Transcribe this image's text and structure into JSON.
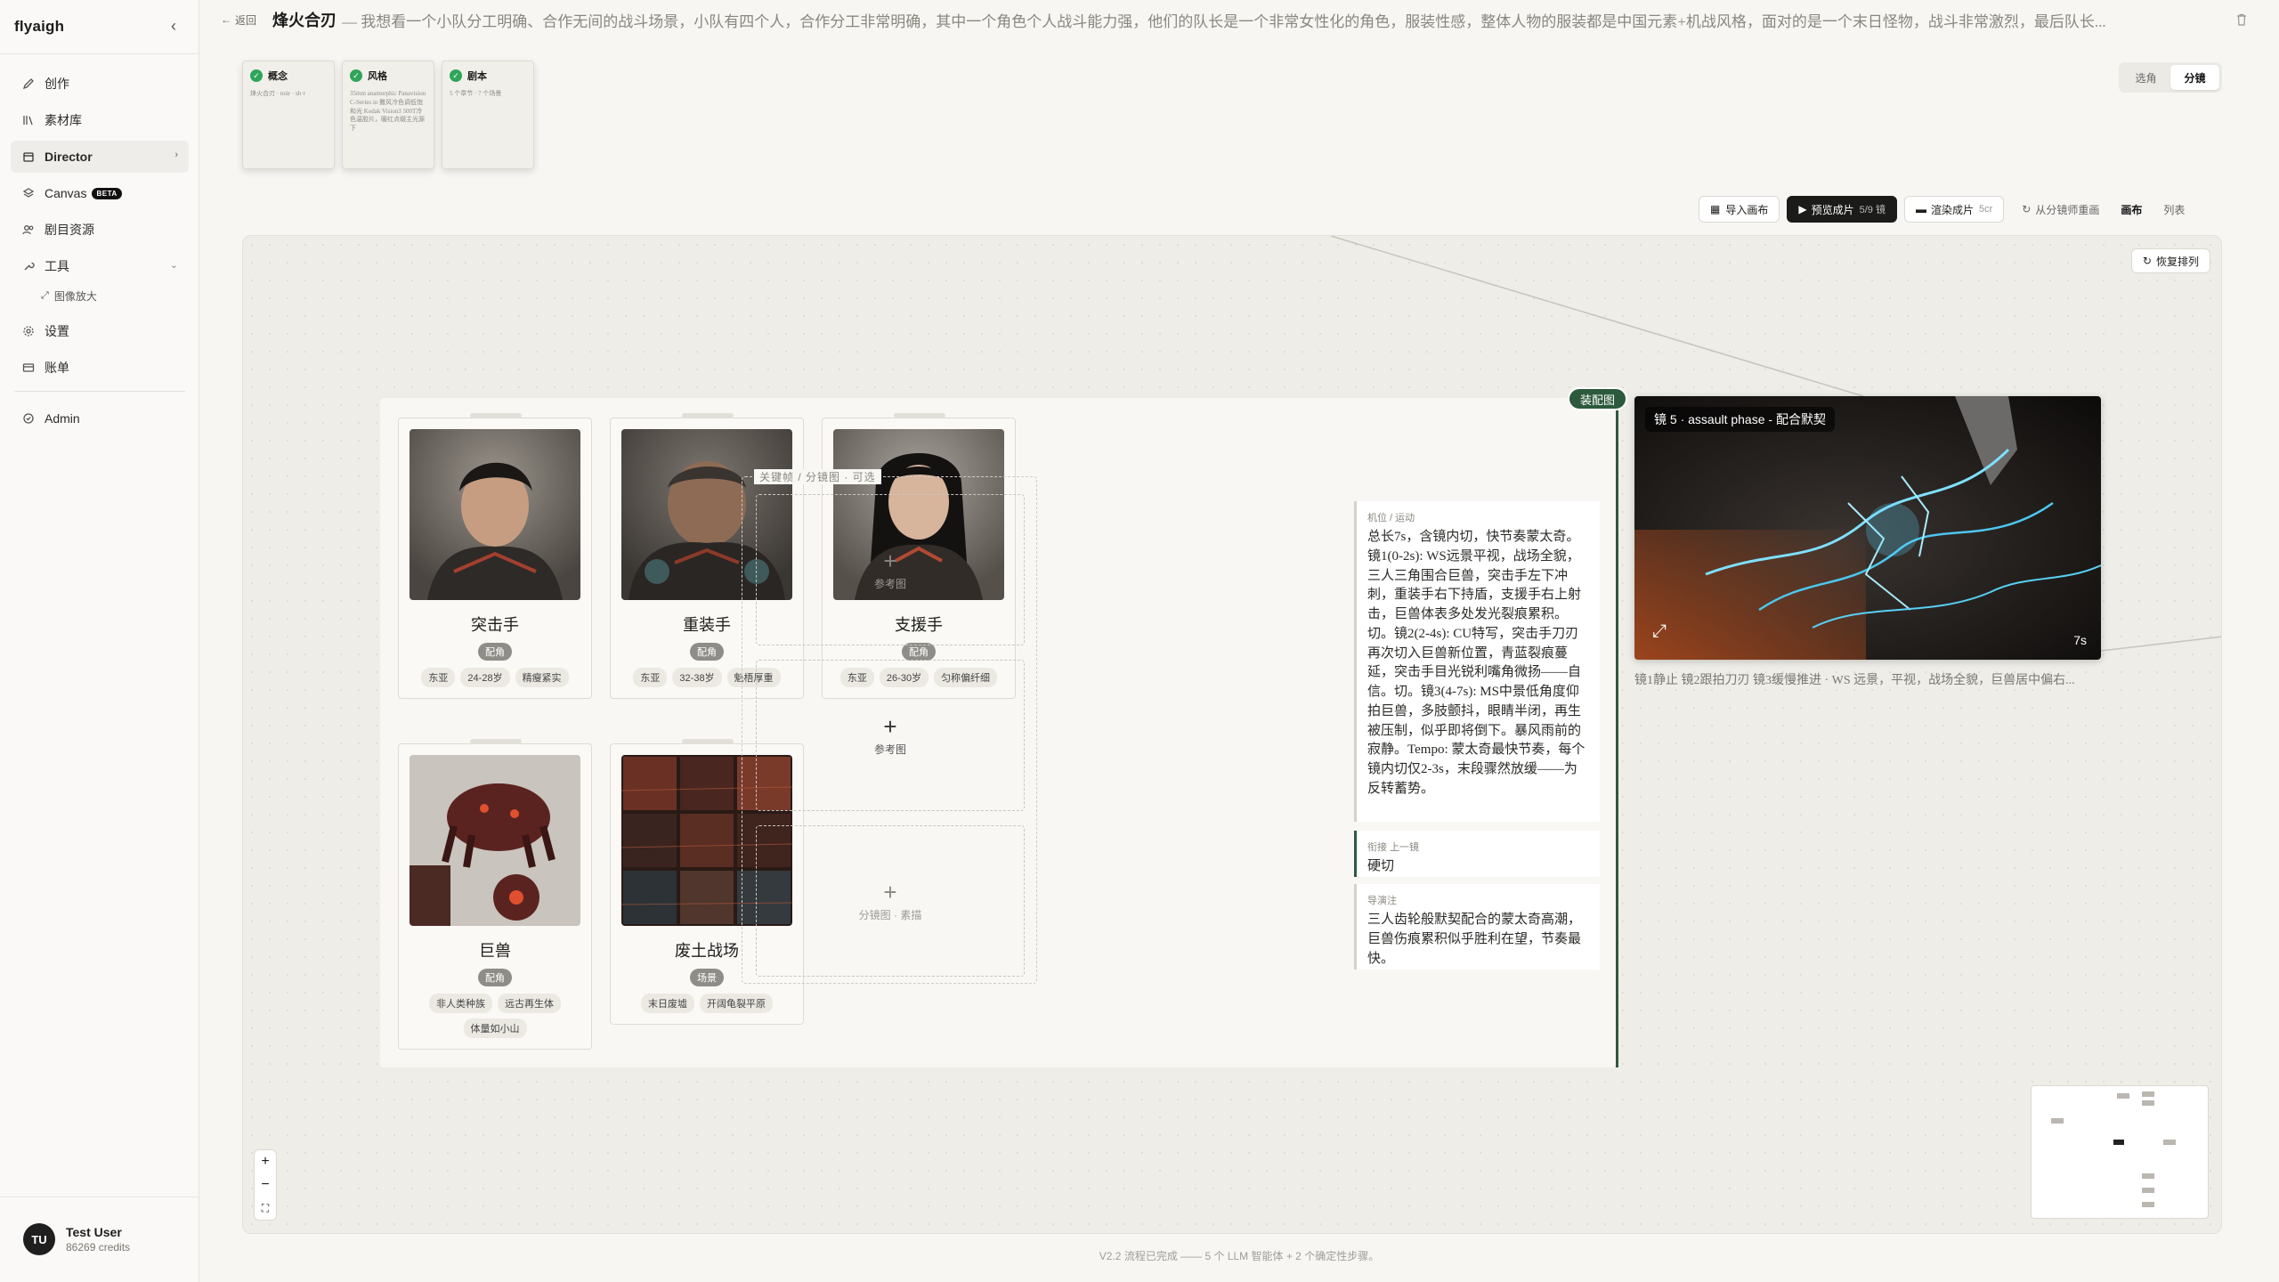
{
  "app": {
    "name": "flyaigh",
    "collapse_icon": "chevron-left-icon"
  },
  "sidebar": {
    "items": [
      {
        "label": "创作",
        "icon": "edit-icon"
      },
      {
        "label": "素材库",
        "icon": "library-icon"
      },
      {
        "label": "Director",
        "icon": "film-icon"
      },
      {
        "label": "Canvas",
        "badge": "BETA",
        "icon": "layers-icon"
      },
      {
        "label": "剧目资源",
        "icon": "users-icon"
      },
      {
        "label": "工具",
        "icon": "wrench-icon"
      },
      {
        "label": "设置",
        "icon": "gear-icon"
      },
      {
        "label": "账单",
        "icon": "card-icon"
      },
      {
        "label": "Admin",
        "icon": "shield-icon"
      }
    ],
    "subitems": [
      {
        "label": "图像放大",
        "icon": "expand-icon"
      }
    ],
    "user": {
      "initials": "TU",
      "name": "Test User",
      "credits": "86269 credits"
    }
  },
  "header": {
    "back_label": "返回",
    "title": "烽火合刃",
    "description": "— 我想看一个小队分工明确、合作无间的战斗场景，小队有四个人，合作分工非常明确，其中一个角色个人战斗能力强，他们的队长是一个非常女性化的角色，服装性感，整体人物的服装都是中国元素+机战风格，面对的是一个末日怪物，战斗非常激烈，最后队长..."
  },
  "stages": [
    {
      "label": "概念",
      "sub": "烽火合刃 · noir · sh·r"
    },
    {
      "label": "风格",
      "sub": "35mm anamorphic Panavision C-Series in 撒风冷色调低饱和光 Kodak Vision3 500T冷色温胶片，暖红点缀主光源下"
    },
    {
      "label": "剧本",
      "sub": "5 个章节 · 7 个场景"
    }
  ],
  "mode_toggle": {
    "left": "选角",
    "right": "分镜"
  },
  "toolbar": {
    "import": "导入画布",
    "preview": "预览成片",
    "preview_count": "5/9 镜",
    "render": "渲染成片",
    "render_count": "5cr",
    "redraw": "从分镜师重画",
    "view_canvas": "画布",
    "view_list": "列表"
  },
  "canvas": {
    "reset_label": "恢复排列",
    "board_tag": "装配图",
    "characters": [
      {
        "name": "突击手",
        "role": "配角",
        "tags": [
          "东亚",
          "24-28岁",
          "精瘦紧实"
        ]
      },
      {
        "name": "重装手",
        "role": "配角",
        "tags": [
          "东亚",
          "32-38岁",
          "魁梧厚重"
        ]
      },
      {
        "name": "支援手",
        "role": "配角",
        "tags": [
          "东亚",
          "26-30岁",
          "匀称偏纤细"
        ]
      },
      {
        "name": "巨兽",
        "role": "配角",
        "tags": [
          "非人类种族",
          "远古再生体",
          "体量如小山"
        ]
      },
      {
        "name": "废土战场",
        "role": "场景",
        "tags": [
          "末日废墟",
          "开阔龟裂平原"
        ]
      }
    ],
    "keyframe_label": "关键帧 / 分镜图 · 可选",
    "ref_boxes": [
      "参考图",
      "参考图",
      "分镜图 · 素描"
    ],
    "info": [
      {
        "caption": "机位 / 运动",
        "text": "总长7s，含镜内切，快节奏蒙太奇。镜1(0-2s): WS远景平视，战场全貌，三人三角围合巨兽，突击手左下冲刺，重装手右下持盾，支援手右上射击，巨兽体表多处发光裂痕累积。切。镜2(2-4s): CU特写，突击手刀刃再次切入巨兽新位置，青蓝裂痕蔓延，突击手目光锐利嘴角微扬——自信。切。镜3(4-7s): MS中景低角度仰拍巨兽，多肢颤抖，眼睛半闭，再生被压制，似乎即将倒下。暴风雨前的寂静。Tempo: 蒙太奇最快节奏，每个镜内切仅2-3s，末段骤然放缓——为反转蓄势。"
      },
      {
        "caption": "衔接 上一镜",
        "text": "硬切"
      },
      {
        "caption": "导演注",
        "text": "三人齿轮般默契配合的蒙太奇高潮，巨兽伤痕累积似乎胜利在望，节奏最快。"
      }
    ],
    "shot": {
      "title": "镜 5 · assault phase - 配合默契",
      "duration": "7s",
      "caption": "镜1静止 镜2跟拍刀刃 镜3缓慢推进 · WS 远景，平视，战场全貌，巨兽居中偏右..."
    },
    "zoom": {
      "in": "+",
      "out": "−",
      "fit": "⛶"
    }
  },
  "footer": "V2.2 流程已完成 —— 5 个 LLM 智能体 + 2 个确定性步骤。",
  "colors": {
    "accent": "#2d5a3d",
    "check": "#2fa55a",
    "dark": "#1b1b1a"
  }
}
